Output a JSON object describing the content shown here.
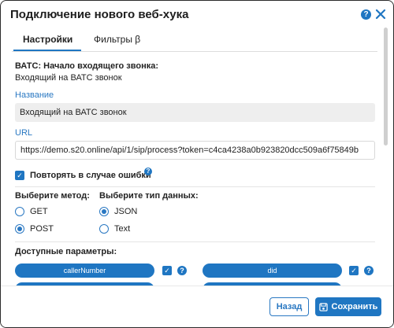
{
  "dialog": {
    "title": "Подключение нового веб-хука",
    "help_icon_text": "?"
  },
  "tabs": [
    {
      "label": "Настройки",
      "active": true
    },
    {
      "label": "Фильтры β",
      "active": false
    }
  ],
  "event": {
    "heading": "ВАТС: Начало входящего звонка:",
    "description": "Входящий на ВАТС звонок"
  },
  "name_field": {
    "label": "Название",
    "value": "Входящий на ВАТС звонок"
  },
  "url_field": {
    "label": "URL",
    "value": "https://demo.s20.online/api/1/sip/process?token=c4ca4238a0b923820dcc509a6f75849b"
  },
  "retry": {
    "label": "Повторять в случае ошибки",
    "checked": true
  },
  "method": {
    "label": "Выберите метод:",
    "options": [
      {
        "label": "GET",
        "selected": false
      },
      {
        "label": "POST",
        "selected": true
      }
    ]
  },
  "data_type": {
    "label": "Выберите тип данных:",
    "options": [
      {
        "label": "JSON",
        "selected": true
      },
      {
        "label": "Text",
        "selected": false
      }
    ]
  },
  "params": {
    "label": "Доступные параметры:",
    "items": [
      {
        "label": "callerNumber",
        "checked": true
      },
      {
        "label": "did",
        "checked": true
      }
    ]
  },
  "footer": {
    "back_label": "Назад",
    "save_label": "Сохранить"
  },
  "colors": {
    "accent": "#1f76c2",
    "link_label": "#2a78c2"
  }
}
